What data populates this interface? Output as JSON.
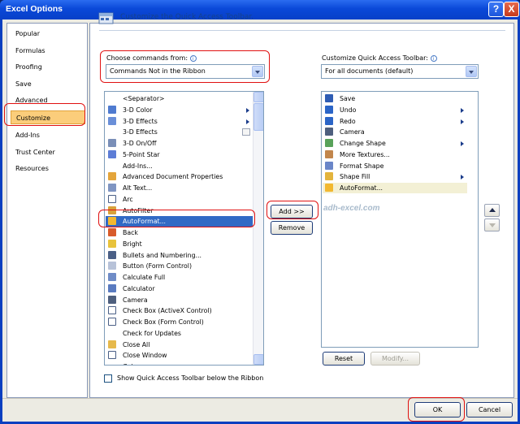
{
  "window": {
    "title": "Excel Options",
    "help_label": "?",
    "close_label": "X"
  },
  "nav": {
    "items": [
      {
        "label": "Popular"
      },
      {
        "label": "Formulas"
      },
      {
        "label": "Proofing"
      },
      {
        "label": "Save"
      },
      {
        "label": "Advanced"
      },
      {
        "label": "Customize",
        "selected": true
      },
      {
        "label": "Add-Ins"
      },
      {
        "label": "Trust Center"
      },
      {
        "label": "Resources"
      }
    ]
  },
  "header": {
    "title": "Customize the Quick Access Toolbar."
  },
  "left": {
    "label": "Choose commands from:",
    "combo_value": "Commands Not in the Ribbon",
    "items": [
      {
        "label": "<Separator>",
        "icon": "none"
      },
      {
        "label": "3-D Color",
        "icon": "cube-color-icon",
        "submenu": true
      },
      {
        "label": "3-D Effects",
        "icon": "cube-effects-icon",
        "submenu": true
      },
      {
        "label": "3-D Effects",
        "icon": "none",
        "dropdown": true
      },
      {
        "label": "3-D On/Off",
        "icon": "cube-toggle-icon"
      },
      {
        "label": "5-Point Star",
        "icon": "star-icon"
      },
      {
        "label": "Add-Ins...",
        "icon": "none"
      },
      {
        "label": "Advanced Document Properties",
        "icon": "document-properties-icon"
      },
      {
        "label": "Alt Text...",
        "icon": "alt-text-icon"
      },
      {
        "label": "Arc",
        "icon": "arc-icon"
      },
      {
        "label": "AutoFilter",
        "icon": "filter-icon"
      },
      {
        "label": "AutoFormat...",
        "icon": "autoformat-icon",
        "selected": true
      },
      {
        "label": "Back",
        "icon": "back-icon"
      },
      {
        "label": "Bright",
        "icon": "bright-icon"
      },
      {
        "label": "Bullets and Numbering...",
        "icon": "bullets-icon"
      },
      {
        "label": "Button (Form Control)",
        "icon": "button-control-icon"
      },
      {
        "label": "Calculate Full",
        "icon": "calculate-full-icon"
      },
      {
        "label": "Calculator",
        "icon": "calculator-icon"
      },
      {
        "label": "Camera",
        "icon": "camera-icon"
      },
      {
        "label": "Check Box (ActiveX Control)",
        "icon": "checkbox-icon"
      },
      {
        "label": "Check Box (Form Control)",
        "icon": "checkbox-icon"
      },
      {
        "label": "Check for Updates",
        "icon": "none"
      },
      {
        "label": "Close All",
        "icon": "folder-icon"
      },
      {
        "label": "Close Window",
        "icon": "close-x-icon"
      },
      {
        "label": "Colon",
        "icon": "none"
      }
    ]
  },
  "right": {
    "label": "Customize Quick Access Toolbar:",
    "combo_value": "For all documents (default)",
    "items": [
      {
        "label": "Save",
        "icon": "save-icon"
      },
      {
        "label": "Undo",
        "icon": "undo-icon",
        "submenu": true
      },
      {
        "label": "Redo",
        "icon": "redo-icon",
        "submenu": true
      },
      {
        "label": "Camera",
        "icon": "camera-icon"
      },
      {
        "label": "Change Shape",
        "icon": "change-shape-icon",
        "submenu": true
      },
      {
        "label": "More Textures...",
        "icon": "textures-icon"
      },
      {
        "label": "Format Shape",
        "icon": "format-shape-icon"
      },
      {
        "label": "Shape Fill",
        "icon": "shape-fill-icon",
        "submenu": true
      },
      {
        "label": "AutoFormat...",
        "icon": "autoformat-icon",
        "highlighted": true
      }
    ],
    "reset_label": "Reset",
    "modify_label": "Modify..."
  },
  "middle": {
    "add_label": "Add >>",
    "remove_label": "Remove"
  },
  "watermark": "adh-excel.com",
  "checkbox": {
    "label": "Show Quick Access Toolbar below the Ribbon",
    "checked": false
  },
  "footer": {
    "ok_label": "OK",
    "cancel_label": "Cancel"
  },
  "colors": {
    "titlebar": "#0a48d8",
    "selection": "#316ac5",
    "nav_selected": "#fbcd7b",
    "annotation": "#e01010"
  }
}
